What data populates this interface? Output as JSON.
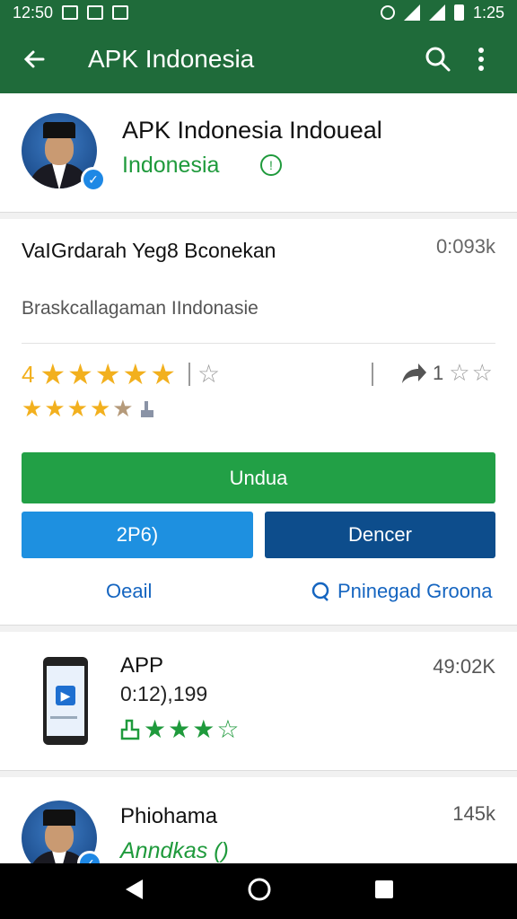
{
  "status": {
    "time_left": "12:50",
    "time_right": "1:25"
  },
  "appbar": {
    "title": "APK Indonesia"
  },
  "header": {
    "title": "APK Indonesia Indoueal",
    "subtitle": "Indonesia"
  },
  "info": {
    "name": "VaIGrdarah Yeg8 Bconekan",
    "size": "0:093k",
    "description": "Braskcallagaman IIndonasie",
    "rating_number": "4",
    "share_count": "1",
    "install_label": "Undua",
    "button_left_label": "2P6)",
    "button_right_label": "Dencer",
    "link_left": "Oeail",
    "link_right": "Pninegad Groona"
  },
  "apps": [
    {
      "name": "APP",
      "line2": "0:12),199",
      "size": "49:02K"
    },
    {
      "name": "Phiohama",
      "line2": "Anndkas ()",
      "size": "145k"
    }
  ],
  "colors": {
    "appbar": "#1f6b3a",
    "install": "#22a046",
    "blue": "#1e90e0",
    "dark_blue": "#0d4d8c",
    "star": "#f2b01e"
  }
}
